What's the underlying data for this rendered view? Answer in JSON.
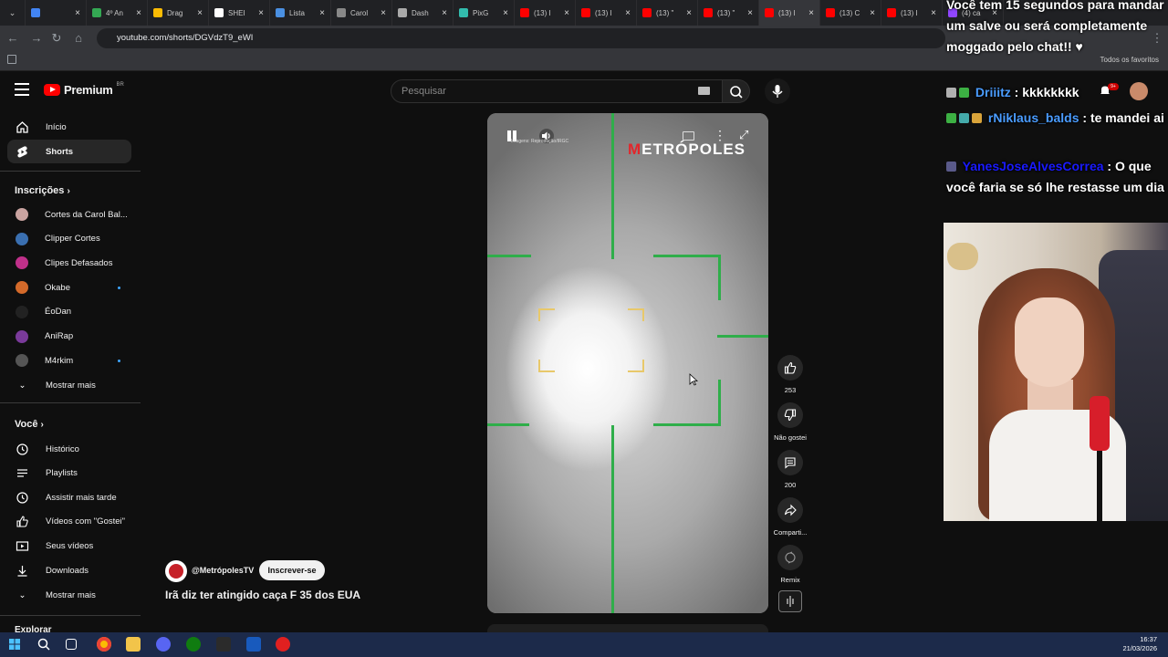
{
  "browser": {
    "tabs": [
      {
        "label": "",
        "color": "#4285f4"
      },
      {
        "label": "4º An",
        "color": "#34a853"
      },
      {
        "label": "Drag",
        "color": "#fbbc04"
      },
      {
        "label": "SHEI",
        "color": "#ffffff"
      },
      {
        "label": "Lista",
        "color": "#4a90e2"
      },
      {
        "label": "Carol",
        "color": "#888888"
      },
      {
        "label": "Dash",
        "color": "#aaaaaa"
      },
      {
        "label": "PixG",
        "color": "#32bcad"
      },
      {
        "label": "(13) I",
        "color": "#ff0000"
      },
      {
        "label": "(13) I",
        "color": "#ff0000"
      },
      {
        "label": "(13) \"",
        "color": "#ff0000"
      },
      {
        "label": "(13) \"",
        "color": "#ff0000"
      },
      {
        "label": "(13) I",
        "color": "#ff0000"
      },
      {
        "label": "(13) C",
        "color": "#ff0000"
      },
      {
        "label": "(13) I",
        "color": "#ff0000"
      },
      {
        "label": "(4) ca",
        "color": "#9146ff"
      }
    ],
    "url": "youtube.com/shorts/DGVdzT9_eWI",
    "bookmarks_folder": "Todos os favoritos"
  },
  "header": {
    "logo_text": "Premium",
    "logo_region": "BR",
    "search_placeholder": "Pesquisar"
  },
  "sidebar": {
    "main": [
      {
        "label": "Início",
        "icon": "home-icon"
      },
      {
        "label": "Shorts",
        "icon": "shorts-icon"
      }
    ],
    "subscriptions_title": "Inscrições",
    "subscriptions": [
      {
        "label": "Cortes da Carol Bal...",
        "color": "#c9a3a0",
        "dot": false
      },
      {
        "label": "Clipper Cortes",
        "color": "#3a6fb0",
        "dot": false
      },
      {
        "label": "Clipes Defasados",
        "color": "#c0308a",
        "dot": false
      },
      {
        "label": "Okabe",
        "color": "#d46a2a",
        "dot": true
      },
      {
        "label": "ÉoDan",
        "color": "#222222",
        "dot": false
      },
      {
        "label": "AniRap",
        "color": "#7a3a9a",
        "dot": false
      },
      {
        "label": "M4rkim",
        "color": "#555555",
        "dot": true
      }
    ],
    "subscriptions_more": "Mostrar mais",
    "you_title": "Você",
    "you": [
      {
        "label": "Histórico",
        "icon": "history-icon"
      },
      {
        "label": "Playlists",
        "icon": "playlists-icon"
      },
      {
        "label": "Assistir mais tarde",
        "icon": "watch-later-icon"
      },
      {
        "label": "Vídeos com \"Gostei\"",
        "icon": "liked-icon"
      },
      {
        "label": "Seus vídeos",
        "icon": "your-videos-icon"
      },
      {
        "label": "Downloads",
        "icon": "downloads-icon"
      }
    ],
    "you_more": "Mostrar mais",
    "explore_title": "Explorar"
  },
  "video": {
    "watermark": "METRÓPOLES",
    "image_credit": "Imagens: Reprodução/IRGC"
  },
  "actions": {
    "likes": "253",
    "dislike": "Não gostei",
    "comments": "200",
    "share": "Comparti...",
    "remix": "Remix"
  },
  "channel": {
    "handle": "@MetrópolesTV",
    "subscribe": "Inscrever-se",
    "title": "Irã diz ter atingido caça F 35 dos EUA"
  },
  "chat": {
    "messages": [
      {
        "user": "",
        "text": "Você tem 15 segundos para mandar um salve ou será completamente moggado pelo chat!! ♥",
        "user_color": "#ffffff"
      },
      {
        "user": "Driiitz",
        "text": "kkkkkkkk",
        "user_color": "#4a9cff"
      },
      {
        "user": "rNiklaus_balds",
        "text": "te mandei ai",
        "user_color": "#4a9cff"
      },
      {
        "user": "YanesJoseAlvesCorrea",
        "text": "O que você faria se só lhe restasse um dia",
        "user_color": "#1a1aff"
      }
    ]
  },
  "taskbar": {
    "time": "16:37",
    "date": "21/03/2026"
  }
}
